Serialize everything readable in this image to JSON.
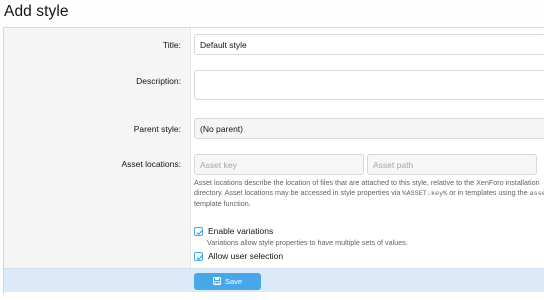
{
  "page": {
    "title": "Add style"
  },
  "form": {
    "title_label": "Title:",
    "title_value": "Default style",
    "description_label": "Description:",
    "description_value": "",
    "parent_label": "Parent style:",
    "parent_value": "(No parent)",
    "asset_label": "Asset locations:",
    "asset_key_placeholder": "Asset key",
    "asset_path_placeholder": "Asset path",
    "asset_hint_1": "Asset locations describe the location of files that are attached to this style, relative to the XenForo installation",
    "asset_hint_2a": "directory. Asset locations may be accessed in style properties via ",
    "asset_hint_code1": "%ASSET:key%",
    "asset_hint_2b": " or in templates using the ",
    "asset_hint_code2": "asse",
    "asset_hint_3": "template function.",
    "enable_variations_label": "Enable variations",
    "enable_variations_checked": true,
    "enable_variations_hint": "Variations allow style properties to have multiple sets of values.",
    "allow_user_selection_label": "Allow user selection",
    "allow_user_selection_checked": true
  },
  "actions": {
    "save_label": "Save"
  },
  "colors": {
    "accent": "#47a7eb",
    "submit_bar": "#dbeaf6",
    "label_col": "#f5f5f5"
  },
  "icons": {
    "save": "save-icon",
    "check": "check-icon"
  }
}
